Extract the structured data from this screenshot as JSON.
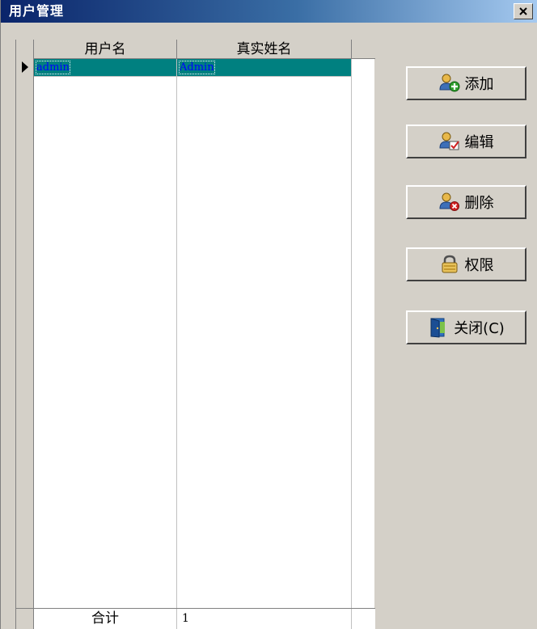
{
  "window": {
    "title": "用户管理",
    "close_glyph": "✕"
  },
  "grid": {
    "columns": [
      "用户名",
      "真实姓名"
    ],
    "rows": [
      {
        "username": "admin",
        "realname": "Admin"
      }
    ],
    "total_label": "合计",
    "total_value": "1"
  },
  "buttons": {
    "add": "添加",
    "edit": "编辑",
    "delete": "删除",
    "permission": "权限",
    "close": "关闭(C)"
  },
  "colors": {
    "titlebar_start": "#0a246a",
    "titlebar_end": "#a6caf0",
    "selected_row_bg": "#008080",
    "selected_row_text": "#0000ff",
    "face": "#d4d0c8"
  },
  "icons": {
    "close": "close-icon",
    "row_pointer": "row-pointer-icon",
    "add": "user-add-icon",
    "edit": "user-edit-icon",
    "delete": "user-delete-icon",
    "permission": "lock-icon",
    "close_window": "exit-door-icon"
  }
}
